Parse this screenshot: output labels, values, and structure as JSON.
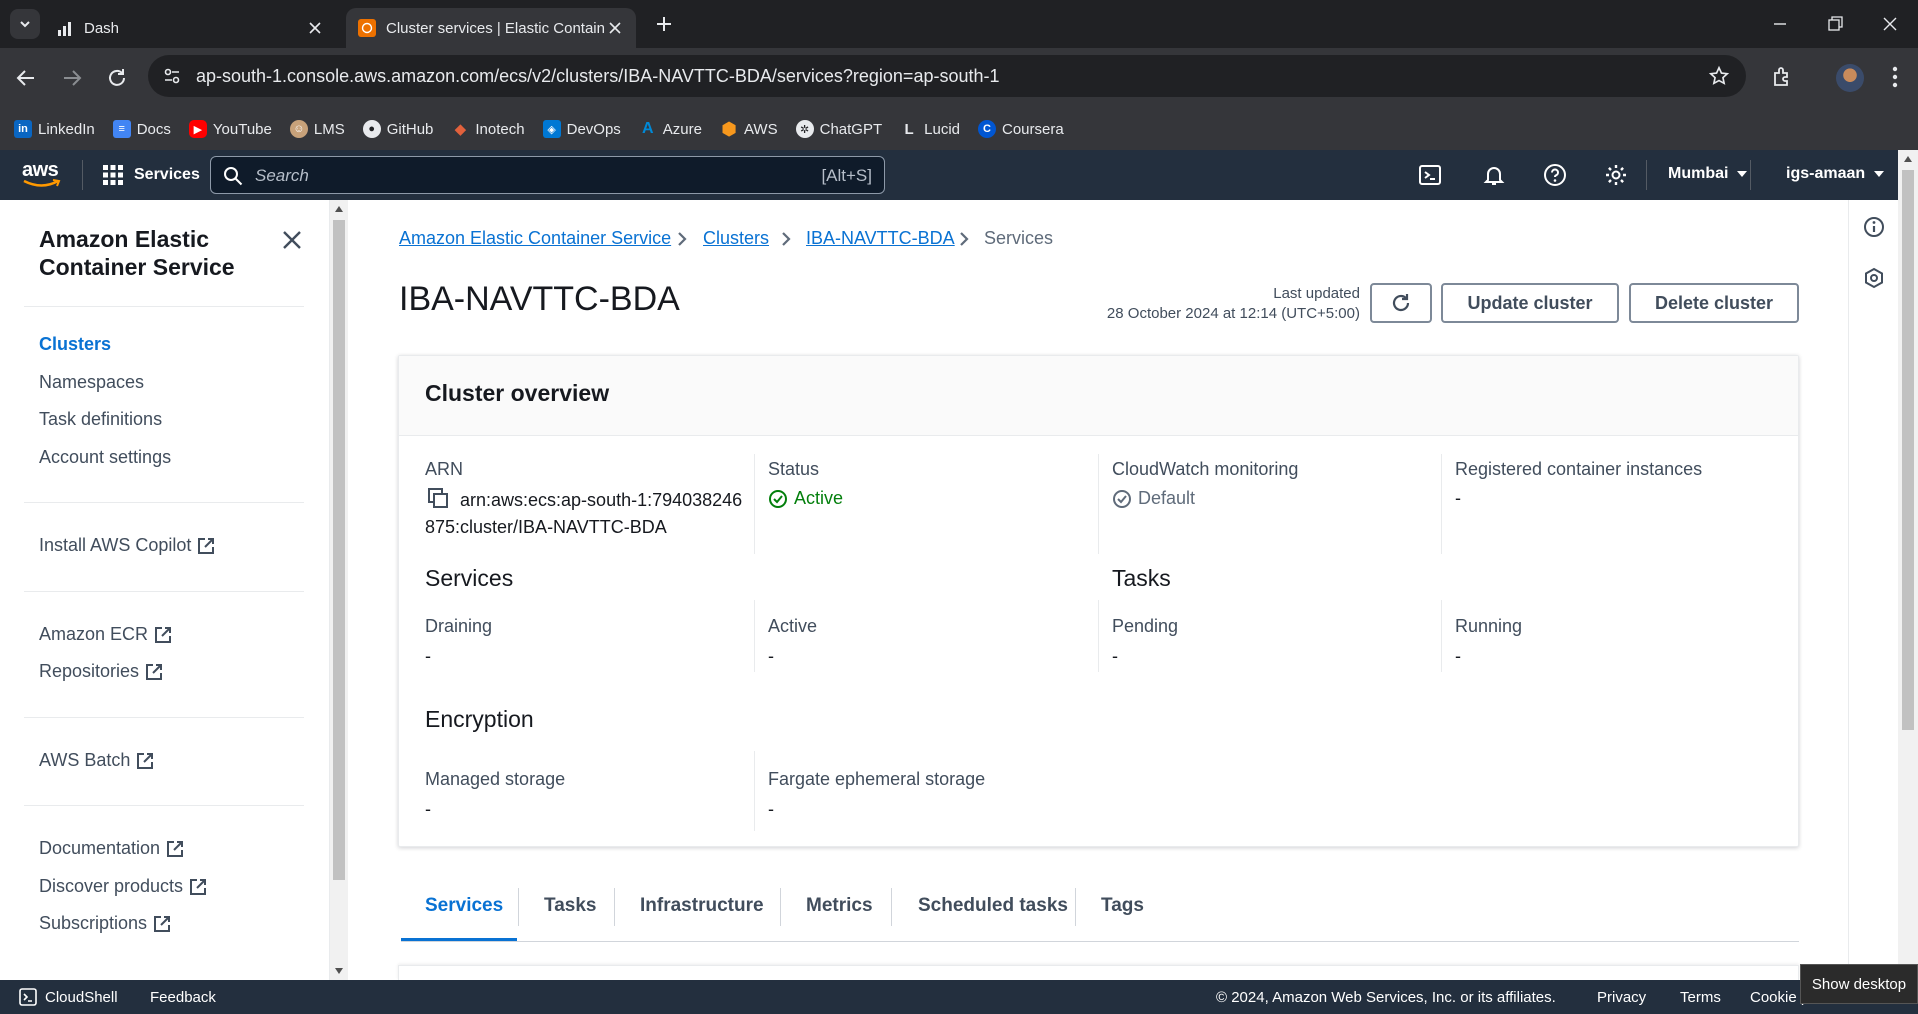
{
  "browser": {
    "tabs": [
      {
        "title": "Dash"
      },
      {
        "title": "Cluster services | Elastic Contain"
      }
    ],
    "url": "ap-south-1.console.aws.amazon.com/ecs/v2/clusters/IBA-NAVTTC-BDA/services?region=ap-south-1",
    "bookmarks": [
      {
        "label": "LinkedIn",
        "icon": "linkedin-icon",
        "color": "#0a66c2",
        "glyph": "in"
      },
      {
        "label": "Docs",
        "icon": "docs-icon",
        "color": "#4285f4",
        "glyph": "≡"
      },
      {
        "label": "YouTube",
        "icon": "youtube-icon",
        "color": "#ff0000",
        "glyph": "▶"
      },
      {
        "label": "LMS",
        "icon": "lms-icon",
        "color": "#c8a27a",
        "glyph": "☺"
      },
      {
        "label": "GitHub",
        "icon": "github-icon",
        "color": "#202124",
        "glyph": "●"
      },
      {
        "label": "Inotech",
        "icon": "inotech-icon",
        "color": "#e2613c",
        "glyph": "◆"
      },
      {
        "label": "DevOps",
        "icon": "devops-icon",
        "color": "#0078d4",
        "glyph": "◈"
      },
      {
        "label": "Azure",
        "icon": "azure-icon",
        "color": "#0089d6",
        "glyph": "A"
      },
      {
        "label": "AWS",
        "icon": "aws-icon",
        "color": "#f7981d",
        "glyph": "⬢"
      },
      {
        "label": "ChatGPT",
        "icon": "chatgpt-icon",
        "color": "#202124",
        "glyph": "✲"
      },
      {
        "label": "Lucid",
        "icon": "lucid-icon",
        "color": "#202124",
        "glyph": "L"
      },
      {
        "label": "Coursera",
        "icon": "coursera-icon",
        "color": "#0056d2",
        "glyph": "C"
      }
    ]
  },
  "aws_nav": {
    "logo": "aws",
    "services_label": "Services",
    "search_placeholder": "Search",
    "search_shortcut": "[Alt+S]",
    "region": "Mumbai",
    "account": "igs-amaan"
  },
  "sidebar": {
    "title_line1": "Amazon Elastic",
    "title_line2": "Container Service",
    "items": [
      {
        "label": "Clusters"
      },
      {
        "label": "Namespaces"
      },
      {
        "label": "Task definitions"
      },
      {
        "label": "Account settings"
      },
      {
        "label": "Install AWS Copilot"
      },
      {
        "label": "Amazon ECR"
      },
      {
        "label": "Repositories"
      },
      {
        "label": "AWS Batch"
      },
      {
        "label": "Documentation"
      },
      {
        "label": "Discover products"
      },
      {
        "label": "Subscriptions"
      }
    ]
  },
  "breadcrumb": {
    "items": [
      "Amazon Elastic Container Service",
      "Clusters",
      "IBA-NAVTTC-BDA"
    ],
    "current": "Services"
  },
  "page": {
    "title": "IBA-NAVTTC-BDA",
    "last_updated_label": "Last updated",
    "last_updated_value": "28 October 2024 at 12:14 (UTC+5:00)",
    "update_button": "Update cluster",
    "delete_button": "Delete cluster"
  },
  "overview": {
    "title": "Cluster overview",
    "arn_label": "ARN",
    "arn_line1": "arn:aws:ecs:ap-south-1:794038246",
    "arn_line2": "875:cluster/IBA-NAVTTC-BDA",
    "status_label": "Status",
    "status_value": "Active",
    "status_color": "#037f0c",
    "cloudwatch_label": "CloudWatch monitoring",
    "cloudwatch_value": "Default",
    "registered_label": "Registered container instances",
    "registered_value": "-",
    "services_heading": "Services",
    "draining_label": "Draining",
    "draining_value": "-",
    "active_label": "Active",
    "active_value": "-",
    "tasks_heading": "Tasks",
    "pending_label": "Pending",
    "pending_value": "-",
    "running_label": "Running",
    "running_value": "-",
    "encryption_heading": "Encryption",
    "managed_label": "Managed storage",
    "managed_value": "-",
    "fargate_label": "Fargate ephemeral storage",
    "fargate_value": "-"
  },
  "content_tabs": [
    "Services",
    "Tasks",
    "Infrastructure",
    "Metrics",
    "Scheduled tasks",
    "Tags"
  ],
  "footer": {
    "cloudshell": "CloudShell",
    "feedback": "Feedback",
    "copyright": "© 2024, Amazon Web Services, Inc. or its affiliates.",
    "privacy": "Privacy",
    "terms": "Terms",
    "cookie": "Cookie preferences"
  },
  "taskbar": {
    "show_desktop": "Show desktop"
  }
}
